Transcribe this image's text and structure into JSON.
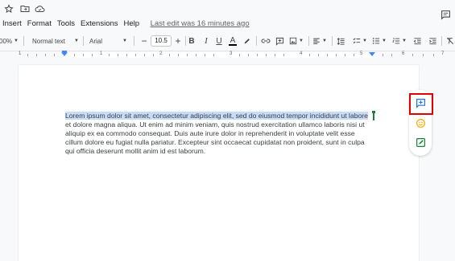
{
  "menu": {
    "items": [
      "Insert",
      "Format",
      "Tools",
      "Extensions",
      "Help"
    ],
    "last_edit": "Last edit was 16 minutes ago"
  },
  "toolbar": {
    "zoom": "00%",
    "style": "Normal text",
    "font": "Arial",
    "font_size": "10.5"
  },
  "ruler": {
    "numbers": [
      "1",
      "1",
      "2",
      "3",
      "4",
      "5",
      "6",
      "7"
    ]
  },
  "document": {
    "selected_text": "Lorem ipsum dolor sit amet, consectetur adipiscing elit, sed do eiusmod tempor incididunt ut labore",
    "lines": [
      "et dolore magna aliqua. Ut enim ad minim veniam, quis nostrud exercitation ullamco laboris nisi ut",
      "aliquip ex ea commodo consequat. Duis aute irure dolor in reprehenderit in voluptate velit esse",
      "cillum dolore eu fugiat nulla pariatur. Excepteur sint occaecat cupidatat non proident, sunt in culpa",
      "qui officia deserunt mollit anim id est laborum."
    ]
  },
  "colors": {
    "selection": "#c8dbf7",
    "highlight_box": "#e00000",
    "add_comment_icon": "#1a73e8",
    "emoji_icon": "#f9ab00",
    "suggest_icon": "#188038"
  }
}
